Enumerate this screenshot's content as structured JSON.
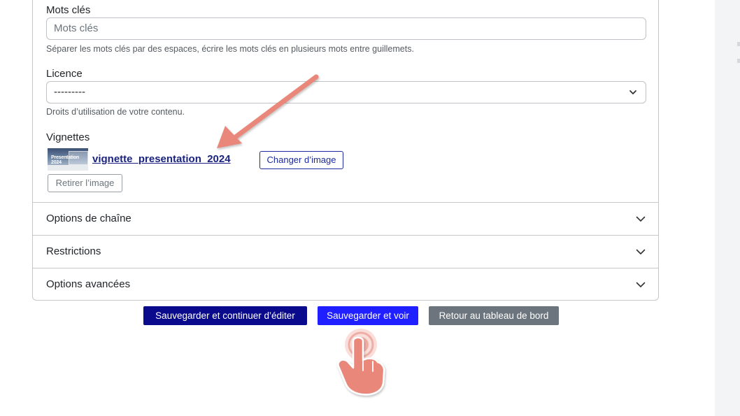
{
  "form": {
    "keywords": {
      "label": "Mots clés",
      "placeholder": "Mots clés",
      "help": "Séparer les mots clés par des espaces, écrire les mots clés en plusieurs mots entre guillemets."
    },
    "licence": {
      "label": "Licence",
      "selected": "---------",
      "help": "Droits d’utilisation de votre contenu."
    },
    "thumbnails": {
      "label": "Vignettes",
      "thumbnail_text": "Presentation 2024",
      "file_name": "vignette_presentation_2024",
      "change_button": "Changer d’image",
      "remove_button": "Retirer l’image"
    }
  },
  "accordion": [
    {
      "label": "Options de chaîne"
    },
    {
      "label": "Restrictions"
    },
    {
      "label": "Options avancées"
    }
  ],
  "actions": {
    "save_continue": "Sauvegarder et continuer d’éditer",
    "save_view": "Sauvegarder et voir",
    "back_dashboard": "Retour au tableau de bord"
  },
  "icons": {
    "accordion_toggle": "chevron-down-icon",
    "select_toggle": "chevron-down-icon",
    "annotation_arrow": "arrow-icon",
    "annotation_hand": "pointing-hand-icon"
  },
  "colors": {
    "annotation": "#e8877a",
    "primary_dark": "#0a0a8c",
    "primary": "#1f1fff",
    "secondary": "#6c757d"
  }
}
